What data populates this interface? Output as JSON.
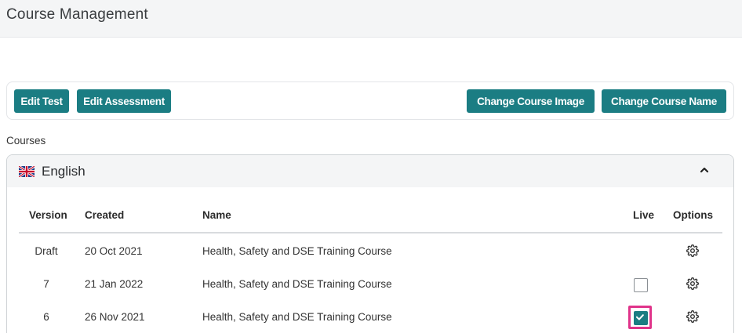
{
  "page": {
    "title": "Course Management"
  },
  "toolbar": {
    "edit_test": "Edit Test",
    "edit_assessment": "Edit Assessment",
    "change_image": "Change Course Image",
    "change_name": "Change Course Name"
  },
  "courses_label": "Courses",
  "accordion": {
    "language": "English",
    "flag": "uk-flag-icon",
    "expanded": true
  },
  "table": {
    "headers": {
      "version": "Version",
      "created": "Created",
      "name": "Name",
      "live": "Live",
      "options": "Options"
    },
    "rows": [
      {
        "version": "Draft",
        "created": "20 Oct 2021",
        "name": "Health, Safety and DSE Training Course",
        "live": null,
        "options_icon": "gear-icon"
      },
      {
        "version": "7",
        "created": "21 Jan 2022",
        "name": "Health, Safety and DSE Training Course",
        "live": false,
        "options_icon": "gear-icon"
      },
      {
        "version": "6",
        "created": "26 Nov 2021",
        "name": "Health, Safety and DSE Training Course",
        "live": true,
        "options_icon": "gear-icon"
      }
    ]
  },
  "colors": {
    "accent": "#1b7d83",
    "highlight": "#e0338a"
  }
}
